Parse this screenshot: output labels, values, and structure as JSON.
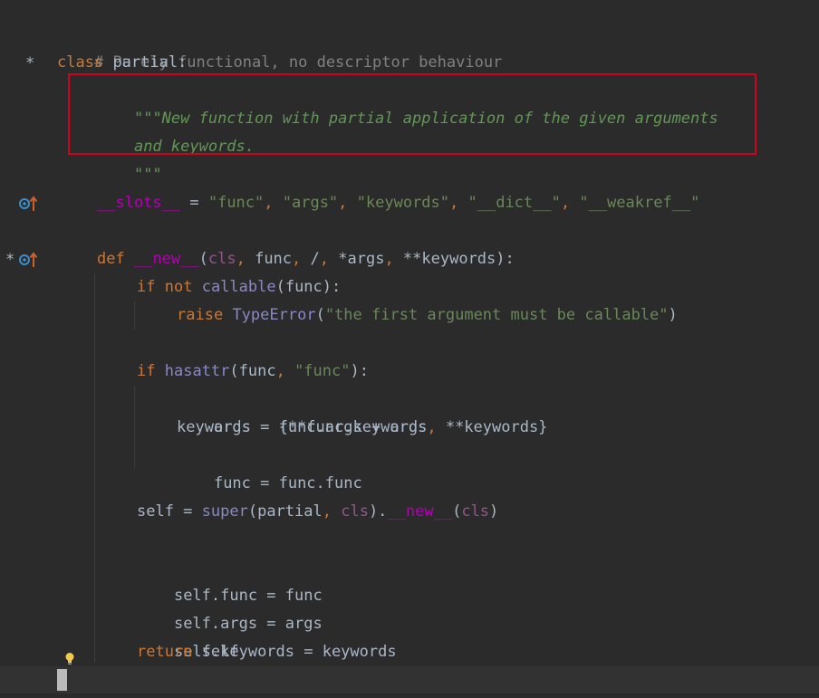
{
  "gutter": {
    "class_marker": "*",
    "new_marker": "*"
  },
  "code": {
    "l1_comment": "# Purely functional, no descriptor behaviour",
    "l2_kw": "class",
    "l2_name": "partial:",
    "l3_doc": "\"\"\"New function with partial application of the given arguments",
    "l4_doc": "and keywords.",
    "l5_doc": "\"\"\"",
    "l6_slots": "__slots__",
    "l6_eq": " = ",
    "l6_s1": "\"func\"",
    "l6_s2": "\"args\"",
    "l6_s3": "\"keywords\"",
    "l6_s4": "\"__dict__\"",
    "l6_s5": "\"__weakref__\"",
    "l6_comma": ", ",
    "l7_def": "def",
    "l7_name": "__new__",
    "l7_open": "(",
    "l7_cls": "cls",
    "l7_c": ", ",
    "l7_func": "func",
    "l7_slash": "/",
    "l7_args": "*args",
    "l7_kw": "**keywords",
    "l7_close": "):",
    "l8_if": "if",
    "l8_not": "not",
    "l8_callable": "callable",
    "l8_rest": "(func):",
    "l9_raise": "raise",
    "l9_te": "TypeError",
    "l9_open": "(",
    "l9_str": "\"the first argument must be callable\"",
    "l9_close": ")",
    "l10_if": "if",
    "l10_hasattr": "hasattr",
    "l10_a": "(func",
    "l10_comma": ", ",
    "l10_str": "\"func\"",
    "l10_close": "):",
    "l11": "args = func.args + args",
    "l12_a": "keywords = {**func.keywords",
    "l12_comma": ", ",
    "l12_b": "**keywords}",
    "l13": "func = func.func",
    "l14_self": "self = ",
    "l14_super": "super",
    "l14_a": "(partial",
    "l14_comma": ", ",
    "l14_cls": "cls",
    "l14_b": ").",
    "l14_new": "__new__",
    "l14_c": "(",
    "l14_cls2": "cls",
    "l14_d": ")",
    "l15": "self.func = func",
    "l16": "self.args = args",
    "l17": "self.keywords = keywords",
    "l18_return": "return",
    "l18_self": " self"
  },
  "colors": {
    "background": "#2b2b2b",
    "keyword": "#cc7832",
    "docstring": "#629755",
    "string": "#6a8759",
    "dunder": "#b200b2",
    "highlight_border": "#d0021b"
  },
  "icons": {
    "override": "override-up-arrow-icon",
    "bulb": "lightbulb-icon"
  }
}
